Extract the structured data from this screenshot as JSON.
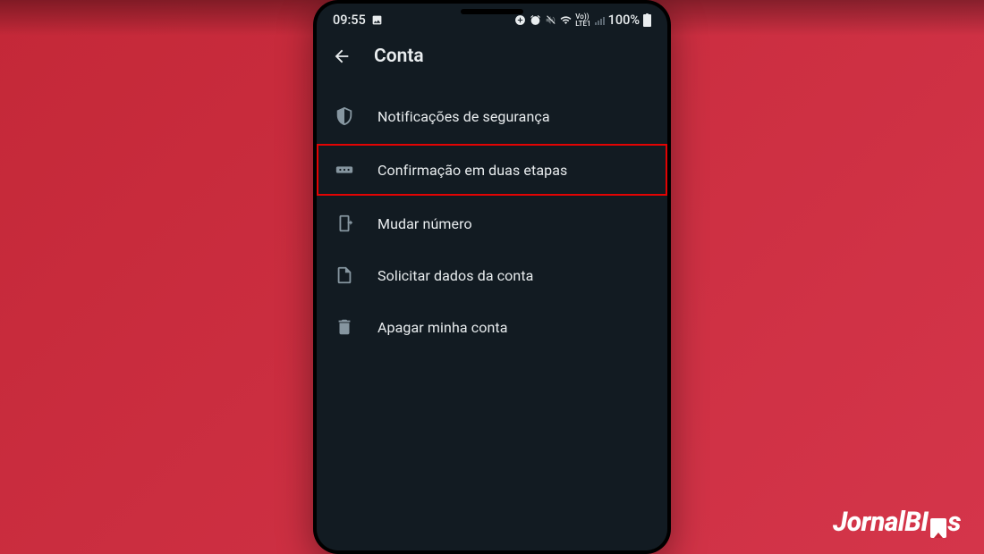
{
  "statusbar": {
    "time": "09:55",
    "battery_pct": "100%",
    "network_label": "VoLTE1"
  },
  "header": {
    "title": "Conta"
  },
  "menu": {
    "items": [
      {
        "label": "Notificações de segurança",
        "icon": "shield-icon",
        "highlighted": false
      },
      {
        "label": "Confirmação em duas etapas",
        "icon": "dots-icon",
        "highlighted": true
      },
      {
        "label": "Mudar número",
        "icon": "sim-swap-icon",
        "highlighted": false
      },
      {
        "label": "Solicitar dados da conta",
        "icon": "document-icon",
        "highlighted": false
      },
      {
        "label": "Apagar minha conta",
        "icon": "trash-icon",
        "highlighted": false
      }
    ]
  },
  "watermark": {
    "text_before": "JornalBI",
    "text_after": "s"
  },
  "colors": {
    "background": "#c42838",
    "phone_bg": "#121b22",
    "text": "#e9edef",
    "icon": "#8696a0",
    "highlight_border": "#e20303"
  }
}
